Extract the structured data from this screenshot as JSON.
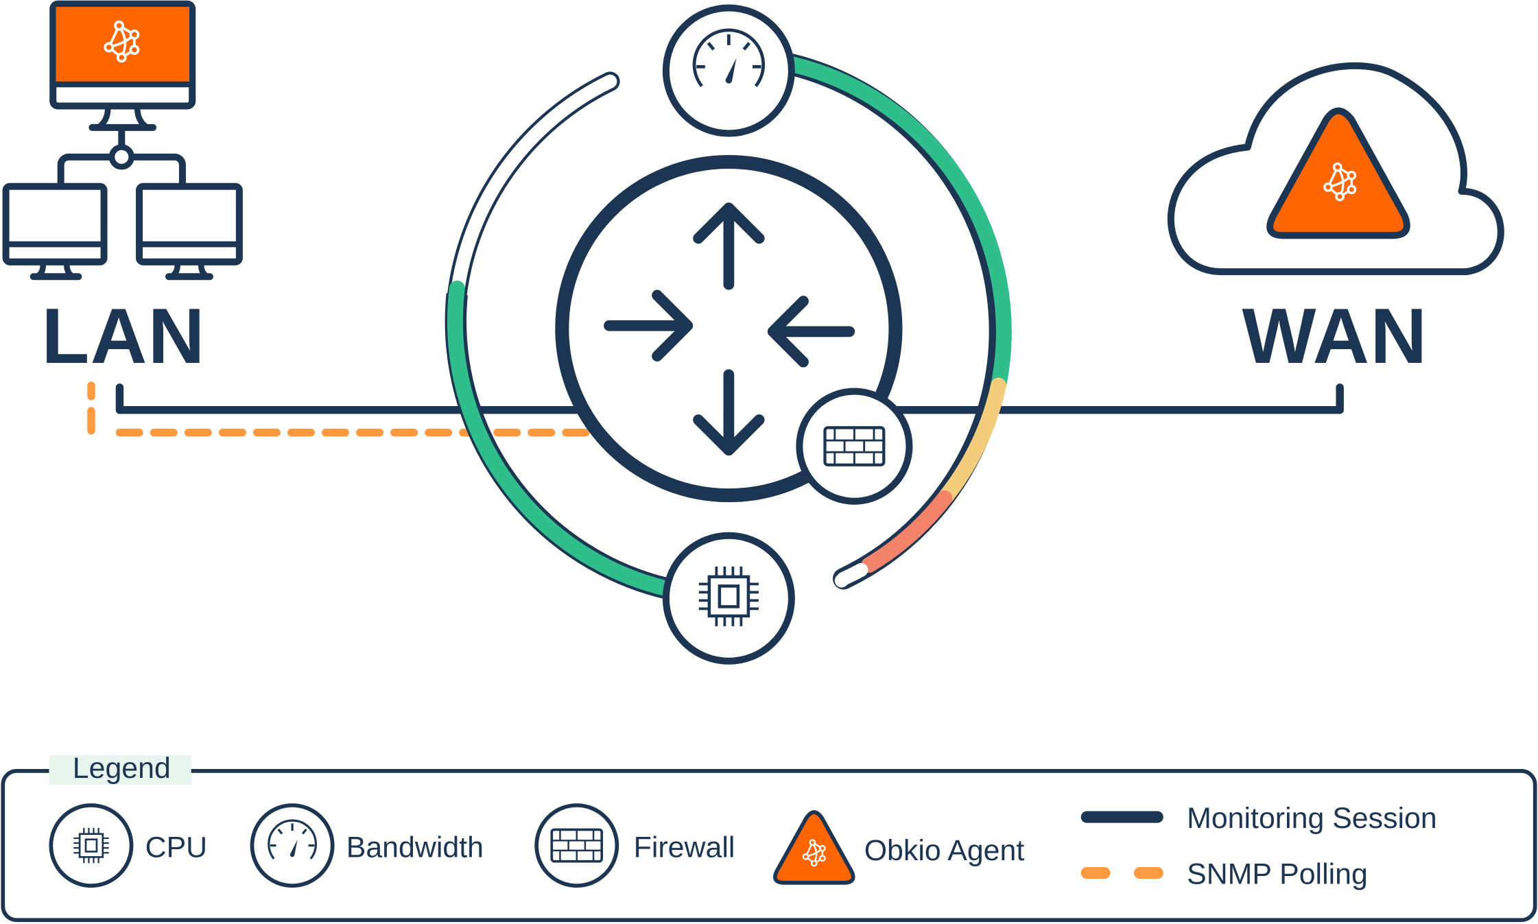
{
  "labels": {
    "lan": "LAN",
    "wan": "WAN"
  },
  "legend": {
    "title": "Legend",
    "items": [
      {
        "icon": "cpu-icon",
        "label": "CPU"
      },
      {
        "icon": "bandwidth-gauge-icon",
        "label": "Bandwidth"
      },
      {
        "icon": "firewall-icon",
        "label": "Firewall"
      },
      {
        "icon": "obkio-agent-icon",
        "label": "Obkio Agent"
      }
    ],
    "lines": [
      {
        "style": "solid",
        "label": "Monitoring Session"
      },
      {
        "style": "dashed",
        "label": "SNMP Polling"
      }
    ]
  },
  "nodes": {
    "lan_agent": "obkio-agent-desktop",
    "router": "router",
    "bandwidth": "bandwidth-gauge",
    "firewall": "firewall",
    "cpu": "cpu",
    "wan_agent": "obkio-agent-cloud"
  },
  "colors": {
    "navy": "#1c3553",
    "orange": "#ff6600",
    "snmp_orange": "#ff9a40",
    "green": "#30be8c",
    "yellow": "#f3cc7c",
    "red": "#f2826a",
    "legend_title_bg": "#e8f5ef"
  }
}
